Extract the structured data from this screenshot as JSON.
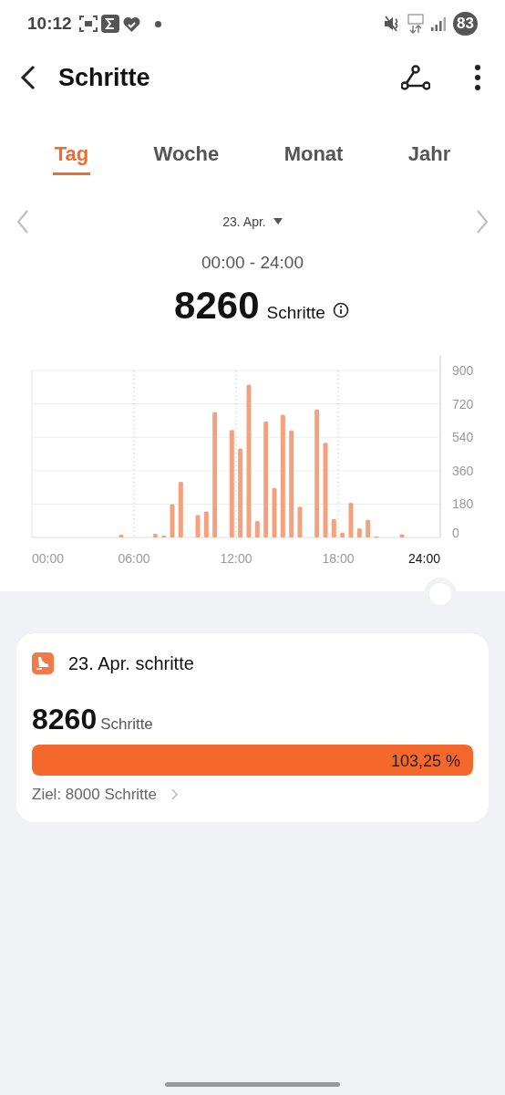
{
  "status_bar": {
    "time": "10:12",
    "battery": "83"
  },
  "app_bar": {
    "title": "Schritte"
  },
  "tabs": [
    {
      "label": "Tag",
      "selected": true
    },
    {
      "label": "Woche",
      "selected": false
    },
    {
      "label": "Monat",
      "selected": false
    },
    {
      "label": "Jahr",
      "selected": false
    }
  ],
  "date_selector": {
    "date": "23. Apr."
  },
  "summary": {
    "range": "00:00 - 24:00",
    "steps": "8260",
    "unit": "Schritte"
  },
  "chart_data": {
    "type": "bar",
    "grid": true,
    "xlim": [
      0,
      24
    ],
    "ylim": [
      0,
      900
    ],
    "x": [
      5.25,
      7.25,
      7.75,
      8.25,
      8.75,
      9.75,
      10.25,
      10.75,
      11.75,
      12.25,
      12.75,
      13.25,
      13.75,
      14.25,
      14.75,
      15.25,
      15.75,
      16.75,
      17.25,
      17.75,
      18.25,
      18.75,
      19.25,
      19.75,
      20.25,
      21.75
    ],
    "series": [
      {
        "color": "#f4a27e",
        "values": [
          15,
          20,
          10,
          179,
          300,
          121,
          140,
          676,
          579,
          480,
          824,
          88,
          626,
          267,
          662,
          577,
          166,
          690,
          510,
          100,
          26,
          187,
          49,
          95,
          5,
          17
        ]
      }
    ],
    "xticks": [
      {
        "value": 0,
        "label": "00:00"
      },
      {
        "value": 6,
        "label": "06:00"
      },
      {
        "value": 12,
        "label": "12:00"
      },
      {
        "value": 18,
        "label": "18:00"
      },
      {
        "value": 24,
        "label": "24:00"
      }
    ],
    "yticks": [
      0,
      180,
      360,
      540,
      720,
      900
    ]
  },
  "card": {
    "title": "23. Apr. schritte",
    "steps": "8260",
    "unit": "Schritte",
    "level": 1,
    "percent": "103,25 %",
    "goal": "Ziel: 8000 Schritte"
  }
}
